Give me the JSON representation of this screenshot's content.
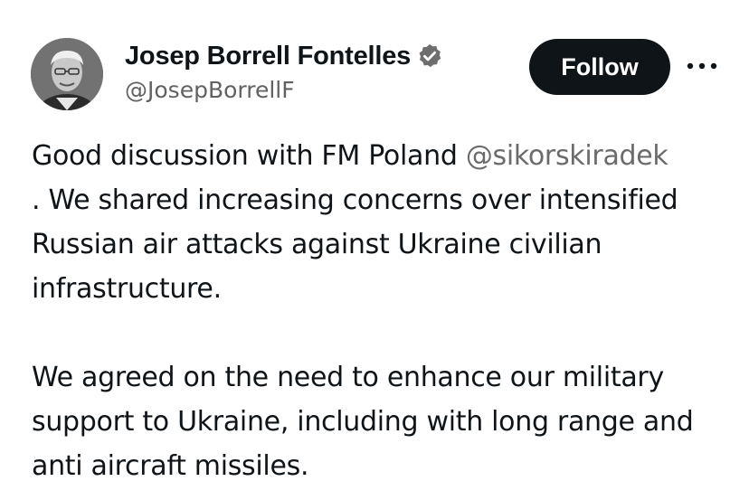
{
  "author": {
    "display_name": "Josep Borrell Fontelles",
    "handle": "@JosepBorrellF",
    "verified": true,
    "avatar_icon": "profile-photo"
  },
  "actions": {
    "follow_label": "Follow",
    "more_icon": "more-horizontal-icon"
  },
  "tweet": {
    "line1_before": "Good discussion with FM Poland ",
    "mention": "@sikorskiradek",
    "line1_after": ". We shared increasing concerns over intensified Russian air attacks against Ukraine civilian infrastructure.",
    "paragraph2": "We agreed on the need to enhance our military support to Ukraine, including with long range and anti aircraft missiles."
  },
  "colors": {
    "text": "#0f1419",
    "secondary": "#536471",
    "button_bg": "#0f1419",
    "button_text": "#ffffff"
  }
}
